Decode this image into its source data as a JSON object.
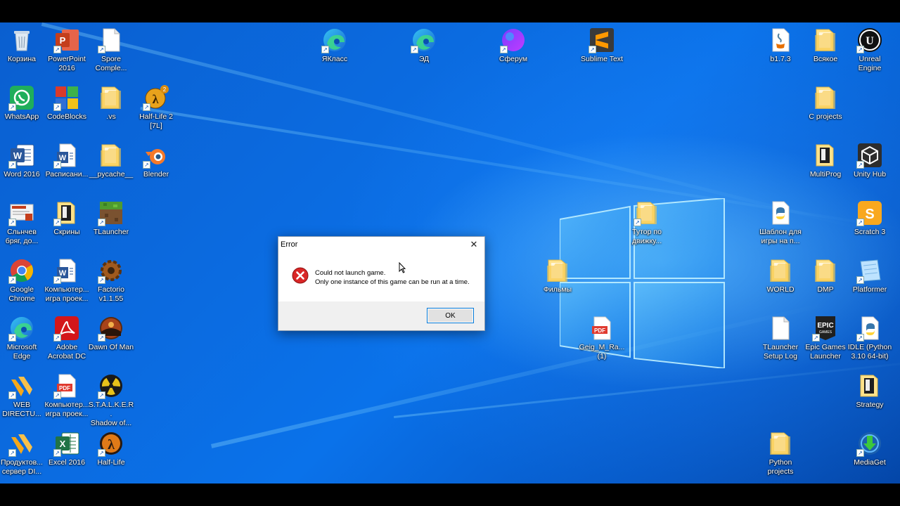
{
  "desktop": {
    "icons": [
      {
        "label": "Корзина",
        "icon": "recycle-bin-icon",
        "shortcut": false
      },
      {
        "label": "PowerPoint\n2016",
        "icon": "powerpoint-icon",
        "shortcut": true
      },
      {
        "label": "Spore\nComple...",
        "icon": "file-icon",
        "shortcut": true
      },
      {
        "label": "WhatsApp",
        "icon": "whatsapp-icon",
        "shortcut": true
      },
      {
        "label": "CodeBlocks",
        "icon": "codeblocks-icon",
        "shortcut": true
      },
      {
        "label": ".vs",
        "icon": "folder-icon",
        "shortcut": false
      },
      {
        "label": "Half-Life 2\n[7L]",
        "icon": "half-life-2-icon",
        "shortcut": true
      },
      {
        "label": "Word 2016",
        "icon": "word-icon",
        "shortcut": true
      },
      {
        "label": "Расписани...",
        "icon": "word-document-icon",
        "shortcut": true
      },
      {
        "label": "__pycache__",
        "icon": "folder-icon",
        "shortcut": false
      },
      {
        "label": "Blender",
        "icon": "blender-icon",
        "shortcut": true
      },
      {
        "label": "Сльнчев\nбряг, до...",
        "icon": "powerpoint-document-icon",
        "shortcut": true
      },
      {
        "label": "Скрины",
        "icon": "folder-dark-icon",
        "shortcut": true
      },
      {
        "label": "TLauncher",
        "icon": "tlauncher-icon",
        "shortcut": true
      },
      {
        "label": "Google\nChrome",
        "icon": "chrome-icon",
        "shortcut": true
      },
      {
        "label": "Компьютер...\nигра проек...",
        "icon": "word-document-icon",
        "shortcut": true
      },
      {
        "label": "Factorio\nv1.1.55",
        "icon": "factorio-icon",
        "shortcut": true
      },
      {
        "label": "Microsoft\nEdge",
        "icon": "edge-icon",
        "shortcut": true
      },
      {
        "label": "Adobe\nAcrobat DC",
        "icon": "acrobat-icon",
        "shortcut": true
      },
      {
        "label": "Dawn Of Man",
        "icon": "dawn-of-man-icon",
        "shortcut": true
      },
      {
        "label": "WEB\nDIRECTU...",
        "icon": "web-director-icon",
        "shortcut": true
      },
      {
        "label": "Компьютер...\nигра проек...",
        "icon": "pdf-document-icon",
        "shortcut": true
      },
      {
        "label": "S.T.A.L.K.E.R.\nShadow of...",
        "icon": "stalker-icon",
        "shortcut": true
      },
      {
        "label": "Продуктов...\nсервер DI...",
        "icon": "server-icon",
        "shortcut": true
      },
      {
        "label": "Excel 2016",
        "icon": "excel-icon",
        "shortcut": true
      },
      {
        "label": "Half-Life",
        "icon": "half-life-icon",
        "shortcut": true
      },
      {
        "label": "ЯКласс",
        "icon": "edge-icon",
        "shortcut": true
      },
      {
        "label": "ЭД",
        "icon": "edge-icon",
        "shortcut": true
      },
      {
        "label": "Сферум",
        "icon": "sferum-icon",
        "shortcut": true
      },
      {
        "label": "Sublime Text",
        "icon": "sublime-text-icon",
        "shortcut": true
      },
      {
        "label": "Тутор по\nдвижку...",
        "icon": "folder-icon",
        "shortcut": true
      },
      {
        "label": "Фильмы",
        "icon": "folder-icon",
        "shortcut": false
      },
      {
        "label": "Geig_M_Ra...\n(1)",
        "icon": "pdf-document-icon",
        "shortcut": false
      },
      {
        "label": "b1.7.3",
        "icon": "java-icon",
        "shortcut": false
      },
      {
        "label": "Всякое",
        "icon": "folder-icon",
        "shortcut": false
      },
      {
        "label": "Unreal\nEngine",
        "icon": "unreal-engine-icon",
        "shortcut": true
      },
      {
        "label": "C projects",
        "icon": "folder-icon",
        "shortcut": false
      },
      {
        "label": "MultiProg",
        "icon": "folder-dark-icon",
        "shortcut": false
      },
      {
        "label": "Unity Hub",
        "icon": "unity-hub-icon",
        "shortcut": true
      },
      {
        "label": "Шаблон для\nигры на п...",
        "icon": "python-file-icon",
        "shortcut": false
      },
      {
        "label": "Scratch 3",
        "icon": "scratch-icon",
        "shortcut": true
      },
      {
        "label": "WORLD",
        "icon": "folder-icon",
        "shortcut": false
      },
      {
        "label": "DMP",
        "icon": "folder-icon",
        "shortcut": false
      },
      {
        "label": "Platformer",
        "icon": "platformer-icon",
        "shortcut": true
      },
      {
        "label": "TLauncher\nSetup Log",
        "icon": "file-icon",
        "shortcut": false
      },
      {
        "label": "Epic Games\nLauncher",
        "icon": "epic-games-icon",
        "shortcut": true
      },
      {
        "label": "IDLE (Python\n3.10 64-bit)",
        "icon": "python-idle-icon",
        "shortcut": true
      },
      {
        "label": "Strategy",
        "icon": "folder-dark-icon",
        "shortcut": false
      },
      {
        "label": "Python\nprojects",
        "icon": "folder-icon",
        "shortcut": false
      },
      {
        "label": "MediaGet",
        "icon": "mediaget-icon",
        "shortcut": true
      }
    ]
  },
  "dialog": {
    "title": "Error",
    "line1": "Could not launch game.",
    "line2": "Only one instance of this game can be run at a time.",
    "ok_label": "OK",
    "close_glyph": "✕"
  }
}
